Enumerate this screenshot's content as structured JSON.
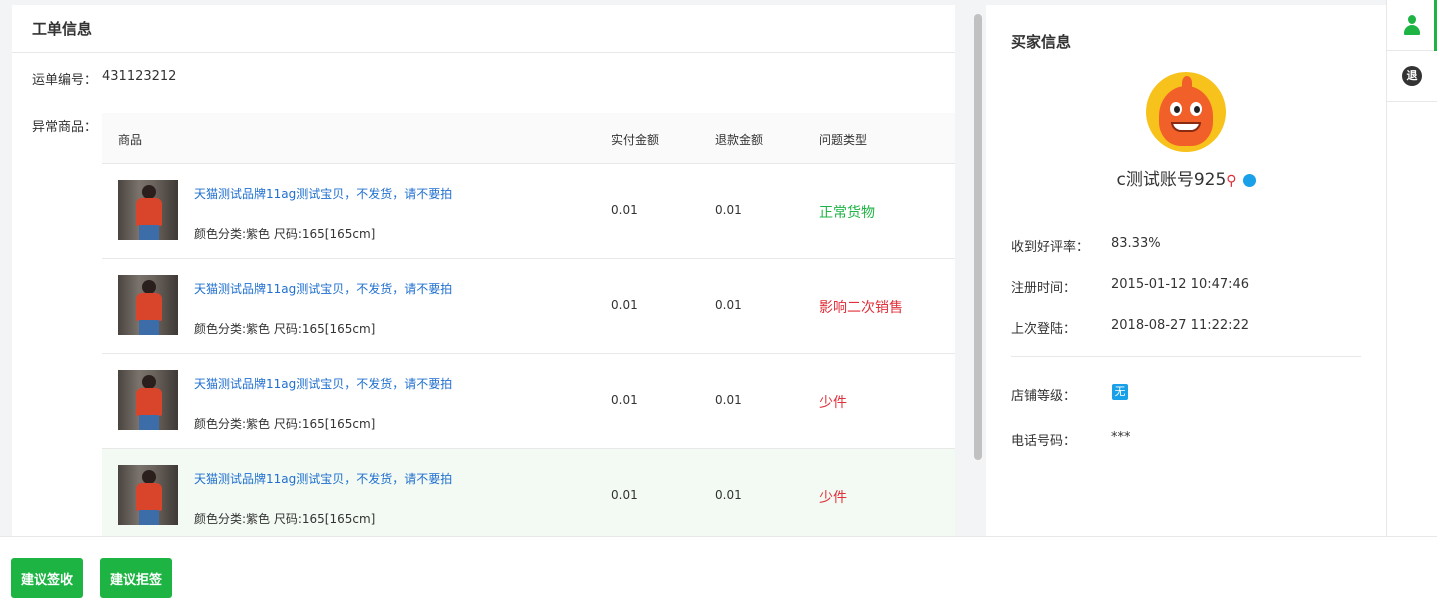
{
  "work_order": {
    "title": "工单信息",
    "waybill_label": "运单编号：",
    "waybill_value": "431123212",
    "abnormal_label": "异常商品：",
    "columns": {
      "product": "商品",
      "paid": "实付金额",
      "refund": "退款金额",
      "issue": "问题类型"
    },
    "rows": [
      {
        "name": "天猫测试品牌11ag测试宝贝，不发货，请不要拍",
        "sku": "颜色分类:紫色 尺码:165[165cm]",
        "paid": "0.01",
        "refund": "0.01",
        "issue": "正常货物",
        "issue_color": "#1db444"
      },
      {
        "name": "天猫测试品牌11ag测试宝贝，不发货，请不要拍",
        "sku": "颜色分类:紫色 尺码:165[165cm]",
        "paid": "0.01",
        "refund": "0.01",
        "issue": "影响二次销售",
        "issue_color": "#e0303a"
      },
      {
        "name": "天猫测试品牌11ag测试宝贝，不发货，请不要拍",
        "sku": "颜色分类:紫色 尺码:165[165cm]",
        "paid": "0.01",
        "refund": "0.01",
        "issue": "少件",
        "issue_color": "#e0303a"
      },
      {
        "name": "天猫测试品牌11ag测试宝贝，不发货，请不要拍",
        "sku": "颜色分类:紫色 尺码:165[165cm]",
        "paid": "0.01",
        "refund": "0.01",
        "issue": "少件",
        "issue_color": "#e0303a"
      }
    ]
  },
  "buyer": {
    "title": "买家信息",
    "name": "c测试账号925",
    "key_glyph": "⚲",
    "good_rate_label": "收到好评率：",
    "good_rate_value": "83.33%",
    "register_label": "注册时间：",
    "register_value": "2015-01-12 10:47:46",
    "last_login_label": "上次登陆：",
    "last_login_value": "2018-08-27 11:22:22",
    "shop_level_label": "店铺等级：",
    "shop_level_value": "无",
    "phone_label": "电话号码：",
    "phone_value": "***"
  },
  "sidebar": {
    "refund_glyph": "退"
  },
  "footer": {
    "sign_button": "建议签收",
    "reject_button": "建议拒签"
  },
  "colors": {
    "accent": "#1db444",
    "link": "#1f6fcf",
    "danger": "#e0303a",
    "badge": "#1aa0e8"
  }
}
